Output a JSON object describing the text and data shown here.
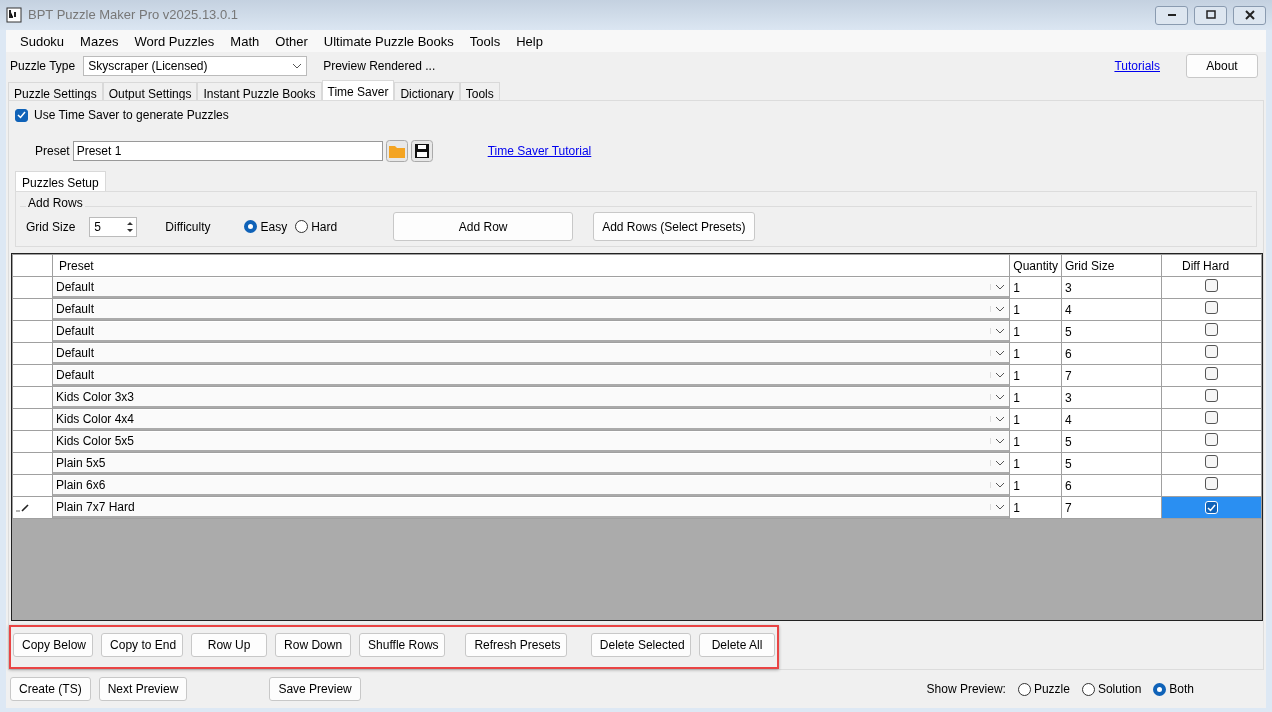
{
  "window": {
    "title": "BPT Puzzle Maker Pro v2025.13.0.1"
  },
  "menu": [
    "Sudoku",
    "Mazes",
    "Word Puzzles",
    "Math",
    "Other",
    "Ultimate Puzzle Books",
    "Tools",
    "Help"
  ],
  "toolbar": {
    "puzzle_type_label": "Puzzle Type",
    "puzzle_type": "Skyscraper (Licensed)",
    "status": "Preview Rendered ...",
    "tutorials_link": "Tutorials",
    "about_button": "About"
  },
  "tabs": [
    {
      "label": "Puzzle Settings",
      "selected": false
    },
    {
      "label": "Output Settings",
      "selected": false
    },
    {
      "label": "Instant Puzzle Books",
      "selected": false
    },
    {
      "label": "Time Saver",
      "selected": true
    },
    {
      "label": "Dictionary",
      "selected": false
    },
    {
      "label": "Tools",
      "selected": false
    }
  ],
  "use_time_saver": {
    "label": "Use Time Saver to generate Puzzles",
    "checked": true
  },
  "preset": {
    "label": "Preset",
    "value": "Preset 1",
    "tutorial_link": "Time Saver Tutorial"
  },
  "inner_tabs": [
    {
      "label": "Puzzles Setup",
      "selected": true
    }
  ],
  "add_rows": {
    "title": "Add Rows",
    "grid_size_label": "Grid Size",
    "grid_size": "5",
    "difficulty_label": "Difficulty",
    "difficulty": [
      {
        "label": "Easy",
        "selected": true
      },
      {
        "label": "Hard",
        "selected": false
      }
    ],
    "add_row_button": "Add Row",
    "add_rows_presets_button": "Add Rows (Select Presets)"
  },
  "table": {
    "columns": [
      "Preset",
      "Quantity",
      "Grid Size",
      "Diff Hard"
    ],
    "rows": [
      {
        "preset": "Default",
        "quantity": "1",
        "grid_size": "3",
        "diff_hard": false,
        "selected": false
      },
      {
        "preset": "Default",
        "quantity": "1",
        "grid_size": "4",
        "diff_hard": false,
        "selected": false
      },
      {
        "preset": "Default",
        "quantity": "1",
        "grid_size": "5",
        "diff_hard": false,
        "selected": false
      },
      {
        "preset": "Default",
        "quantity": "1",
        "grid_size": "6",
        "diff_hard": false,
        "selected": false
      },
      {
        "preset": "Default",
        "quantity": "1",
        "grid_size": "7",
        "diff_hard": false,
        "selected": false
      },
      {
        "preset": "Kids Color 3x3",
        "quantity": "1",
        "grid_size": "3",
        "diff_hard": false,
        "selected": false
      },
      {
        "preset": "Kids Color 4x4",
        "quantity": "1",
        "grid_size": "4",
        "diff_hard": false,
        "selected": false
      },
      {
        "preset": "Kids Color 5x5",
        "quantity": "1",
        "grid_size": "5",
        "diff_hard": false,
        "selected": false
      },
      {
        "preset": "Plain 5x5",
        "quantity": "1",
        "grid_size": "5",
        "diff_hard": false,
        "selected": false
      },
      {
        "preset": "Plain 6x6",
        "quantity": "1",
        "grid_size": "6",
        "diff_hard": false,
        "selected": false
      },
      {
        "preset": "Plain 7x7 Hard",
        "quantity": "1",
        "grid_size": "7",
        "diff_hard": true,
        "selected": true
      }
    ]
  },
  "row_buttons": [
    "Copy Below",
    "Copy to End",
    "Row Up",
    "Row Down",
    "Shuffle Rows",
    "Refresh Presets",
    "Delete Selected",
    "Delete All"
  ],
  "footer": {
    "buttons": [
      "Create (TS)",
      "Next Preview",
      "Save Preview"
    ],
    "show_preview_label": "Show Preview:",
    "show_preview": [
      {
        "label": "Puzzle",
        "selected": false
      },
      {
        "label": "Solution",
        "selected": false
      },
      {
        "label": "Both",
        "selected": true
      }
    ]
  }
}
